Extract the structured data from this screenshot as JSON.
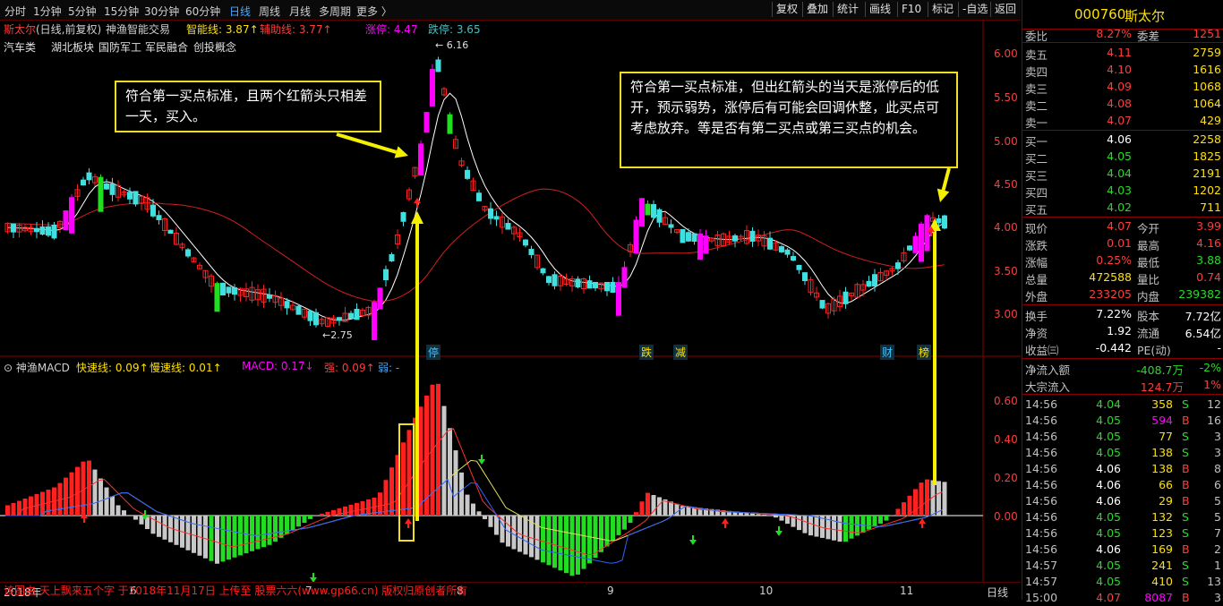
{
  "toolbar": {
    "periods": [
      "分时",
      "1分钟",
      "5分钟",
      "15分钟",
      "30分钟",
      "60分钟",
      "日线",
      "周线",
      "月线",
      "多周期",
      "更多 〉"
    ],
    "active_period": "日线",
    "buttons": [
      "复权",
      "叠加",
      "统计",
      "画线",
      "F10",
      "标记",
      "-自选",
      "返回"
    ]
  },
  "kline_panel": {
    "stock_title": "斯太尔",
    "stock_subtitle": "(日线,前复权)",
    "indicator_name": "神渔智能交易",
    "indicator_line1": "智能线: 3.87↑",
    "indicator_line2": "辅助线: 3.77↑",
    "limit_up": "涨停: 4.47",
    "limit_down": "跌停: 3.65",
    "concepts": [
      "汽车类",
      "湖北板块",
      "国防军工",
      "军民融合",
      "创投概念"
    ],
    "price_axis": [
      "6.00",
      "5.50",
      "5.00",
      "4.50",
      "4.00",
      "3.50",
      "3.00"
    ],
    "high_label": "6.16",
    "low_label": "2.75",
    "event_tags": [
      "停",
      "跌",
      "减",
      "财",
      "榜"
    ]
  },
  "macd_panel": {
    "name": "神渔MACD",
    "fast": "快速线: 0.09↑",
    "slow": "慢速线: 0.01↑",
    "macd": "MACD: 0.17↓",
    "strong": "强: 0.09↑",
    "weak": "弱: -",
    "axis": [
      "0.60",
      "0.40",
      "0.20",
      "0.00"
    ]
  },
  "date_axis": [
    "2018年",
    "6",
    "7",
    "8",
    "9",
    "10",
    "11"
  ],
  "date_axis_right": "日线",
  "footer_text": "该图由 天上飘来五个字 于2018年11月17日 上传至 股票六六(www.gp66.cn) 版权归原创者所有",
  "callouts": {
    "left": "符合第一买点标准，且两个红箭头只相差一天，买入。",
    "right": "符合第一买点标准，但出红箭头的当天是涨停后的低开，预示弱势，涨停后有可能会回调休整，此买点可考虑放弃。等是否有第二买点或第三买点的机会。"
  },
  "quote": {
    "code": "000760",
    "name": "斯太尔",
    "weibi_label": "委比",
    "weibi": "8.27%",
    "weicha_label": "委差",
    "weicha": "1251",
    "asks": [
      {
        "label": "卖五",
        "price": "4.11",
        "vol": "2759"
      },
      {
        "label": "卖四",
        "price": "4.10",
        "vol": "1616"
      },
      {
        "label": "卖三",
        "price": "4.09",
        "vol": "1068"
      },
      {
        "label": "卖二",
        "price": "4.08",
        "vol": "1064"
      },
      {
        "label": "卖一",
        "price": "4.07",
        "vol": "429"
      }
    ],
    "bids": [
      {
        "label": "买一",
        "price": "4.06",
        "vol": "2258"
      },
      {
        "label": "买二",
        "price": "4.05",
        "vol": "1825"
      },
      {
        "label": "买三",
        "price": "4.04",
        "vol": "2191"
      },
      {
        "label": "买四",
        "price": "4.03",
        "vol": "1202"
      },
      {
        "label": "买五",
        "price": "4.02",
        "vol": "711"
      }
    ],
    "stats": [
      {
        "l1": "现价",
        "v1": "4.07",
        "l2": "今开",
        "v2": "3.99"
      },
      {
        "l1": "涨跌",
        "v1": "0.01",
        "l2": "最高",
        "v2": "4.16"
      },
      {
        "l1": "涨幅",
        "v1": "0.25%",
        "l2": "最低",
        "v2": "3.88"
      },
      {
        "l1": "总量",
        "v1": "472588",
        "l2": "量比",
        "v2": "0.74"
      },
      {
        "l1": "外盘",
        "v1": "233205",
        "l2": "内盘",
        "v2": "239382"
      }
    ],
    "stats2": [
      {
        "l1": "换手",
        "v1": "7.22%",
        "l2": "股本",
        "v2": "7.72亿"
      },
      {
        "l1": "净资",
        "v1": "1.92",
        "l2": "流通",
        "v2": "6.54亿"
      },
      {
        "l1": "收益㈢",
        "v1": "-0.442",
        "l2": "PE(动)",
        "v2": "-"
      }
    ],
    "flow": [
      {
        "label": "净流入额",
        "value": "-408.7万",
        "pct": "-2%"
      },
      {
        "label": "大宗流入",
        "value": "124.7万",
        "pct": "1%"
      }
    ],
    "ticks": [
      {
        "t": "14:56",
        "p": "4.04",
        "v": "358",
        "d": "S",
        "n": "12"
      },
      {
        "t": "14:56",
        "p": "4.05",
        "v": "594",
        "d": "B",
        "n": "16"
      },
      {
        "t": "14:56",
        "p": "4.05",
        "v": "77",
        "d": "S",
        "n": "3"
      },
      {
        "t": "14:56",
        "p": "4.05",
        "v": "138",
        "d": "S",
        "n": "3"
      },
      {
        "t": "14:56",
        "p": "4.06",
        "v": "138",
        "d": "B",
        "n": "8"
      },
      {
        "t": "14:56",
        "p": "4.06",
        "v": "66",
        "d": "B",
        "n": "6"
      },
      {
        "t": "14:56",
        "p": "4.06",
        "v": "29",
        "d": "B",
        "n": "5"
      },
      {
        "t": "14:56",
        "p": "4.05",
        "v": "132",
        "d": "S",
        "n": "5"
      },
      {
        "t": "14:56",
        "p": "4.05",
        "v": "123",
        "d": "S",
        "n": "7"
      },
      {
        "t": "14:56",
        "p": "4.06",
        "v": "169",
        "d": "B",
        "n": "2"
      },
      {
        "t": "14:57",
        "p": "4.05",
        "v": "241",
        "d": "S",
        "n": "1"
      },
      {
        "t": "14:57",
        "p": "4.05",
        "v": "410",
        "d": "S",
        "n": "13"
      },
      {
        "t": "15:00",
        "p": "4.07",
        "v": "8087",
        "d": "B",
        "n": "3"
      }
    ]
  },
  "colors": {
    "up": "#ff2020",
    "down": "#22dd22",
    "limit_up_candle": "#ff00ff",
    "panel_border": "#8a0000",
    "callout_border": "#f0e020",
    "arrow": "#f5f000"
  }
}
